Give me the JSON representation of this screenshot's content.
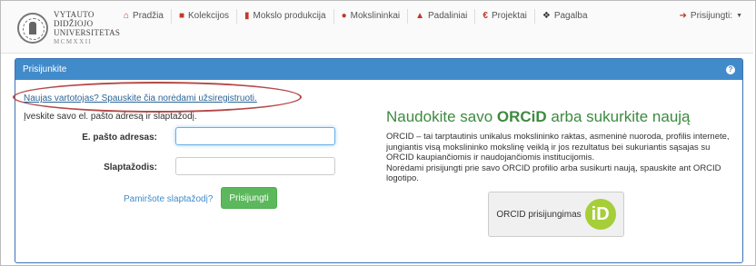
{
  "logo": {
    "line1": "VYTAUTO",
    "line2": "DIDŽIOJO",
    "line3": "UNIVERSITETAS",
    "line4": "MCMXXII"
  },
  "nav": {
    "items": [
      {
        "icon": "home-icon",
        "label": "Pradžia"
      },
      {
        "icon": "folder-icon",
        "label": "Kolekcijos"
      },
      {
        "icon": "book-icon",
        "label": "Mokslo produkcija"
      },
      {
        "icon": "user-icon",
        "label": "Mokslininkai"
      },
      {
        "icon": "institution-icon",
        "label": "Padaliniai"
      },
      {
        "icon": "euro-icon",
        "label": "Projektai"
      },
      {
        "icon": "info-icon",
        "label": "Pagalba"
      }
    ],
    "login_label": "Prisijungti:"
  },
  "panel": {
    "title": "Prisijunkite",
    "register_link": "Naujas vartotojas? Spauskite čia norėdami užsiregistruoti.",
    "instruction": "Įveskite savo el. pašto adresą ir slaptažodį.",
    "email_label": "E. pašto adresas:",
    "password_label": "Slaptažodis:",
    "forgot_link": "Pamiršote slaptažodį?",
    "login_button": "Prisijungti"
  },
  "orcid": {
    "title_pre": "Naudokite savo ",
    "title_brand": "ORCiD",
    "title_post": " arba sukurkite naują",
    "description_1": "ORCID – tai tarptautinis unikalus mokslininko raktas, asmeninė nuoroda, profilis internete, jungiantis visą mokslininko mokslinę veiklą ir jos rezultatus bei sukuriantis sąsajas su ORCID kaupiančiomis ir naudojančiomis institucijomis.",
    "description_2": "Norėdami prisijungti prie savo ORCID profilio arba susikurti naują, spauskite ant ORCID logotipo.",
    "button_label": "ORCID prisijungimas",
    "logo_text": "iD"
  },
  "colors": {
    "accent": "#428bca",
    "success": "#5cb85c",
    "orcid": "#a6ce39",
    "annotation": "#b54848"
  }
}
